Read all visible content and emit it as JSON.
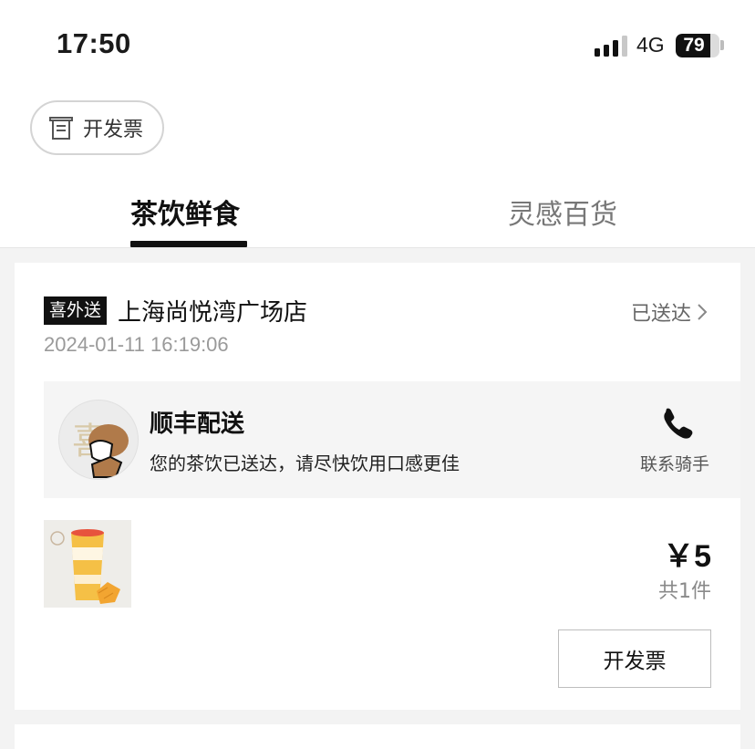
{
  "status_bar": {
    "time": "17:50",
    "network": "4G",
    "battery": "79",
    "battery_level": 0.79,
    "signal_bars_active": 3,
    "signal_bars_total": 4
  },
  "invoice_pill": {
    "label": "开发票",
    "icon": "invoice-icon"
  },
  "tabs": [
    {
      "label": "茶饮鲜食",
      "active": true
    },
    {
      "label": "灵感百货",
      "active": false
    }
  ],
  "order": {
    "badge": "喜外送",
    "store_name": "上海尚悦湾广场店",
    "status": "已送达",
    "datetime": "2024-01-11 16:19:06",
    "courier": {
      "service": "顺丰配送",
      "message": "您的茶饮已送达，请尽快饮用口感更佳",
      "contact_label": "联系骑手",
      "avatar_icon": "courier-avatar-icon",
      "phone_icon": "phone-icon"
    },
    "product": {
      "image": "mango-drink-image",
      "price": "￥5",
      "quantity": "共1件"
    },
    "invoice_button": "开发票"
  },
  "colors": {
    "primary_text": "#111111",
    "secondary_text": "#9a9a9a",
    "page_bg": "#f3f3f3",
    "badge_bg": "#111111"
  }
}
